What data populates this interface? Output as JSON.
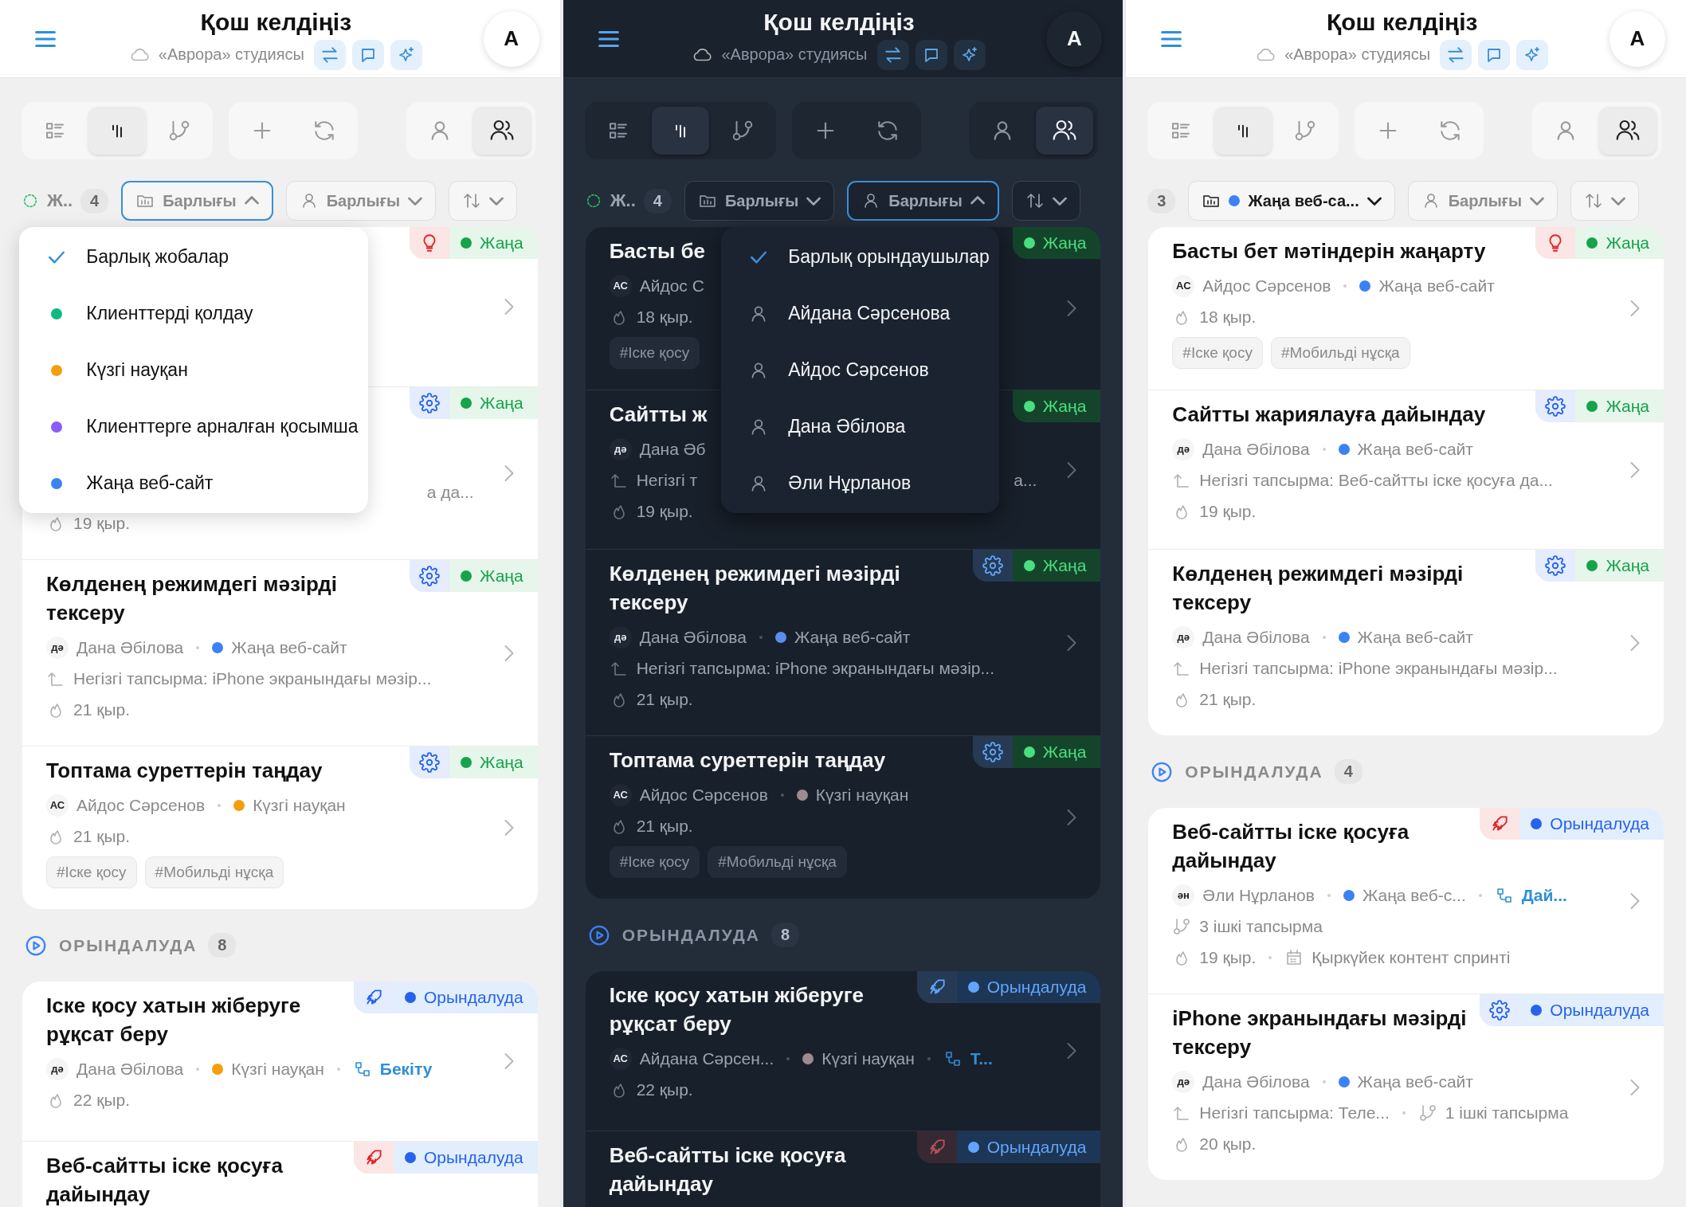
{
  "screens": [
    {
      "dark": false,
      "header": {
        "title": "Қош келдіңіз",
        "subtitle": "«Аврора» студиясы",
        "avatar": "А"
      },
      "toolbar": {
        "views": [
          {
            "selected": false
          },
          {
            "selected": true
          },
          {
            "selected": false
          }
        ],
        "scope": [
          {
            "selected": false
          },
          {
            "selected": true
          }
        ]
      },
      "filters": {
        "status": {
          "label": "Ж..",
          "count": "4"
        },
        "project": {
          "label": "Барлығы",
          "open": true,
          "menu": [
            {
              "label": "Барлық жобалар",
              "selected": true
            },
            {
              "label": "Клиенттерді қолдау",
              "selected": false,
              "color": "#10b981"
            },
            {
              "label": "Күзгі науқан",
              "selected": false,
              "color": "#f59e0b"
            },
            {
              "label": "Клиенттерге арналған қосымша",
              "selected": false,
              "color": "#8b5cf6"
            },
            {
              "label": "Жаңа веб-сайт",
              "selected": false,
              "color": "#3b82f6"
            }
          ]
        },
        "assignee": {
          "label": "Барлығы",
          "open": false
        }
      },
      "sections": [
        {
          "cards": [
            {
              "priority": {
                "kind": "idea",
                "color": "#dc2626"
              },
              "status": {
                "label": "Жаңа",
                "kind": "new"
              }
            },
            {
              "priority": {
                "kind": "settings",
                "color": "#2563eb"
              },
              "status": {
                "label": "Жаңа",
                "kind": "new"
              },
              "lines": [
                [
                  {
                    "kind": "clipped",
                    "text": "а да..."
                  }
                ],
                [
                  {
                    "kind": "due",
                    "text": "19 қыр."
                  }
                ]
              ]
            },
            {
              "title": "Көлденең режимдегі мәзірді тексеру",
              "priority": {
                "kind": "settings",
                "color": "#2563eb"
              },
              "status": {
                "label": "Жаңа",
                "kind": "new"
              },
              "lines": [
                [
                  {
                    "kind": "assignee",
                    "initials": "дә",
                    "text": "Дана Әбілова"
                  },
                  {
                    "kind": "project",
                    "text": "Жаңа веб-сайт",
                    "color": "#3b82f6"
                  }
                ],
                [
                  {
                    "kind": "parent",
                    "text": "Негізгі тапсырма: iPhone экранындағы мәзір..."
                  }
                ],
                [
                  {
                    "kind": "due",
                    "text": "21 қыр."
                  }
                ]
              ]
            },
            {
              "title": "Топтама суреттерін таңдау",
              "priority": {
                "kind": "settings",
                "color": "#2563eb"
              },
              "status": {
                "label": "Жаңа",
                "kind": "new"
              },
              "lines": [
                [
                  {
                    "kind": "assignee",
                    "initials": "АС",
                    "text": "Айдос Сәрсенов"
                  },
                  {
                    "kind": "project",
                    "text": "Күзгі науқан",
                    "color": "#f59e0b"
                  }
                ],
                [
                  {
                    "kind": "due",
                    "text": "21 қыр."
                  }
                ]
              ],
              "tags": [
                "#Іске қосу",
                "#Мобильді нұсқа"
              ]
            }
          ]
        },
        {
          "header": {
            "label": "ОРЫНДАЛУДА",
            "count": "8"
          },
          "cards": [
            {
              "title": "Іске қосу хатын жіберуге рұқсат беру",
              "priority": {
                "kind": "rocket",
                "color": "#2563eb"
              },
              "status": {
                "label": "Орындалуда",
                "kind": "progress"
              },
              "lines": [
                [
                  {
                    "kind": "assignee",
                    "initials": "дә",
                    "text": "Дана Әбілова"
                  },
                  {
                    "kind": "project",
                    "text": "Күзгі науқан",
                    "color": "#f59e0b"
                  },
                  {
                    "kind": "link",
                    "text": "Бекіту"
                  }
                ],
                [
                  {
                    "kind": "due",
                    "text": "22 қыр."
                  }
                ]
              ]
            },
            {
              "title": "Веб-сайтты іске қосуға дайындау",
              "priority": {
                "kind": "rocket",
                "color": "#dc2626"
              },
              "status": {
                "label": "Орындалуда",
                "kind": "progress"
              }
            }
          ]
        }
      ]
    },
    {
      "dark": true,
      "header": {
        "title": "Қош келдіңіз",
        "subtitle": "«Аврора» студиясы",
        "avatar": "А"
      },
      "toolbar": {
        "views": [
          {
            "selected": false
          },
          {
            "selected": true
          },
          {
            "selected": false
          }
        ],
        "scope": [
          {
            "selected": false
          },
          {
            "selected": true
          }
        ]
      },
      "filters": {
        "status": {
          "label": "Ж..",
          "count": "4"
        },
        "project": {
          "label": "Барлығы",
          "open": false
        },
        "assignee": {
          "label": "Барлығы",
          "open": true,
          "menu": [
            {
              "label": "Барлық орындаушылар",
              "selected": true
            },
            {
              "label": "Айдана Сәрсенова",
              "selected": false
            },
            {
              "label": "Айдос Сәрсенов",
              "selected": false
            },
            {
              "label": "Дана Әбілова",
              "selected": false
            },
            {
              "label": "Әли Нұрланов",
              "selected": false
            }
          ]
        }
      },
      "sections": [
        {
          "cards": [
            {
              "title": "Басты бе",
              "status": {
                "label": "Жаңа",
                "kind": "new"
              },
              "lines": [
                [
                  {
                    "kind": "assignee",
                    "initials": "АС",
                    "text": "Айдос С"
                  }
                ],
                [
                  {
                    "kind": "due",
                    "text": "18 қыр."
                  }
                ]
              ],
              "tags": [
                "#Іске қосу"
              ]
            },
            {
              "title": "Сайтты ж",
              "status": {
                "label": "Жаңа",
                "kind": "new"
              },
              "lines": [
                [
                  {
                    "kind": "assignee",
                    "initials": "дә",
                    "text": "Дана Әб"
                  }
                ],
                [
                  {
                    "kind": "parent",
                    "text": "Негізгі т"
                  },
                  {
                    "kind": "clipped",
                    "text": "а..."
                  }
                ],
                [
                  {
                    "kind": "due",
                    "text": "19 қыр."
                  }
                ]
              ]
            },
            {
              "title": "Көлденең режимдегі мәзірді тексеру",
              "priority": {
                "kind": "settings",
                "color": "#60a5fa"
              },
              "status": {
                "label": "Жаңа",
                "kind": "new"
              },
              "lines": [
                [
                  {
                    "kind": "assignee",
                    "initials": "дә",
                    "text": "Дана Әбілова"
                  },
                  {
                    "kind": "project",
                    "text": "Жаңа веб-сайт",
                    "color": "#5b8def"
                  }
                ],
                [
                  {
                    "kind": "parent",
                    "text": "Негізгі тапсырма: iPhone экранындағы мәзір..."
                  }
                ],
                [
                  {
                    "kind": "due",
                    "text": "21 қыр."
                  }
                ]
              ]
            },
            {
              "title": "Топтама суреттерін таңдау",
              "priority": {
                "kind": "settings",
                "color": "#60a5fa"
              },
              "status": {
                "label": "Жаңа",
                "kind": "new"
              },
              "lines": [
                [
                  {
                    "kind": "assignee",
                    "initials": "АС",
                    "text": "Айдос Сәрсенов"
                  },
                  {
                    "kind": "project",
                    "text": "Күзгі науқан",
                    "color": "#9e8a8f"
                  }
                ],
                [
                  {
                    "kind": "due",
                    "text": "21 қыр."
                  }
                ]
              ],
              "tags": [
                "#Іске қосу",
                "#Мобильді нұсқа"
              ]
            }
          ]
        },
        {
          "header": {
            "label": "ОРЫНДАЛУДА",
            "count": "8"
          },
          "cards": [
            {
              "title": "Іске қосу хатын жіберуге рұқсат беру",
              "priority": {
                "kind": "rocket",
                "color": "#60a5fa"
              },
              "status": {
                "label": "Орындалуда",
                "kind": "progress"
              },
              "lines": [
                [
                  {
                    "kind": "assignee",
                    "initials": "АС",
                    "text": "Айдана Сәрсен..."
                  },
                  {
                    "kind": "project",
                    "text": "Күзгі науқан",
                    "color": "#9e8a8f"
                  },
                  {
                    "kind": "link",
                    "text": "Т..."
                  }
                ],
                [
                  {
                    "kind": "due",
                    "text": "22 қыр."
                  }
                ]
              ]
            },
            {
              "title": "Веб-сайтты іске қосуға дайындау",
              "priority": {
                "kind": "rocket",
                "color": "#b3525a"
              },
              "status": {
                "label": "Орындалуда",
                "kind": "progress"
              }
            }
          ]
        }
      ]
    },
    {
      "dark": false,
      "header": {
        "title": "Қош келдіңіз",
        "subtitle": "«Аврора» студиясы",
        "avatar": "А"
      },
      "toolbar": {
        "views": [
          {
            "selected": false
          },
          {
            "selected": true
          },
          {
            "selected": false
          }
        ],
        "scope": [
          {
            "selected": false
          },
          {
            "selected": true
          }
        ]
      },
      "filters": {
        "status": {
          "count": "3"
        },
        "project": {
          "label": "Жаңа веб-са...",
          "color": "#3b82f6",
          "open": false
        },
        "assignee": {
          "label": "Барлығы",
          "open": false
        }
      },
      "sections": [
        {
          "cards": [
            {
              "title": "Басты бет мәтіндерін жаңарту",
              "priority": {
                "kind": "idea",
                "color": "#dc2626"
              },
              "status": {
                "label": "Жаңа",
                "kind": "new"
              },
              "lines": [
                [
                  {
                    "kind": "assignee",
                    "initials": "АС",
                    "text": "Айдос Сәрсенов"
                  },
                  {
                    "kind": "project",
                    "text": "Жаңа веб-сайт",
                    "color": "#3b82f6"
                  }
                ],
                [
                  {
                    "kind": "due",
                    "text": "18 қыр."
                  }
                ]
              ],
              "tags": [
                "#Іске қосу",
                "#Мобильді нұсқа"
              ]
            },
            {
              "title": "Сайтты жариялауға дайындау",
              "priority": {
                "kind": "settings",
                "color": "#2563eb"
              },
              "status": {
                "label": "Жаңа",
                "kind": "new"
              },
              "lines": [
                [
                  {
                    "kind": "assignee",
                    "initials": "дә",
                    "text": "Дана Әбілова"
                  },
                  {
                    "kind": "project",
                    "text": "Жаңа веб-сайт",
                    "color": "#3b82f6"
                  }
                ],
                [
                  {
                    "kind": "parent",
                    "text": "Негізгі тапсырма: Веб-сайтты іске қосуға да..."
                  }
                ],
                [
                  {
                    "kind": "due",
                    "text": "19 қыр."
                  }
                ]
              ]
            },
            {
              "title": "Көлденең режимдегі мәзірді тексеру",
              "priority": {
                "kind": "settings",
                "color": "#2563eb"
              },
              "status": {
                "label": "Жаңа",
                "kind": "new"
              },
              "lines": [
                [
                  {
                    "kind": "assignee",
                    "initials": "дә",
                    "text": "Дана Әбілова"
                  },
                  {
                    "kind": "project",
                    "text": "Жаңа веб-сайт",
                    "color": "#3b82f6"
                  }
                ],
                [
                  {
                    "kind": "parent",
                    "text": "Негізгі тапсырма: iPhone экранындағы мәзір..."
                  }
                ],
                [
                  {
                    "kind": "due",
                    "text": "21 қыр."
                  }
                ]
              ]
            }
          ]
        },
        {
          "header": {
            "label": "ОРЫНДАЛУДА",
            "count": "4"
          },
          "cards": [
            {
              "title": "Веб-сайтты іске қосуға дайындау",
              "priority": {
                "kind": "rocket",
                "color": "#dc2626"
              },
              "status": {
                "label": "Орындалуда",
                "kind": "progress"
              },
              "lines": [
                [
                  {
                    "kind": "assignee",
                    "initials": "ән",
                    "text": "Әли Нұрланов"
                  },
                  {
                    "kind": "project",
                    "text": "Жаңа веб-с...",
                    "color": "#3b82f6"
                  },
                  {
                    "kind": "link",
                    "text": "Дай..."
                  }
                ],
                [
                  {
                    "kind": "subtasks",
                    "text": "3 ішкі тапсырма"
                  }
                ],
                [
                  {
                    "kind": "due",
                    "text": "19 қыр."
                  },
                  {
                    "kind": "sprint",
                    "text": "Қыркүйек контент спринті"
                  }
                ]
              ]
            },
            {
              "title": "iPhone экранындағы мәзірді тексеру",
              "priority": {
                "kind": "settings",
                "color": "#2563eb"
              },
              "status": {
                "label": "Орындалуда",
                "kind": "progress"
              },
              "lines": [
                [
                  {
                    "kind": "assignee",
                    "initials": "дә",
                    "text": "Дана Әбілова"
                  },
                  {
                    "kind": "project",
                    "text": "Жаңа веб-сайт",
                    "color": "#3b82f6"
                  }
                ],
                [
                  {
                    "kind": "parent",
                    "text": "Негізгі тапсырма: Теле..."
                  },
                  {
                    "kind": "subtasks",
                    "text": "1 ішкі тапсырма"
                  }
                ],
                [
                  {
                    "kind": "due",
                    "text": "20 қыр."
                  }
                ]
              ]
            }
          ]
        }
      ]
    }
  ]
}
